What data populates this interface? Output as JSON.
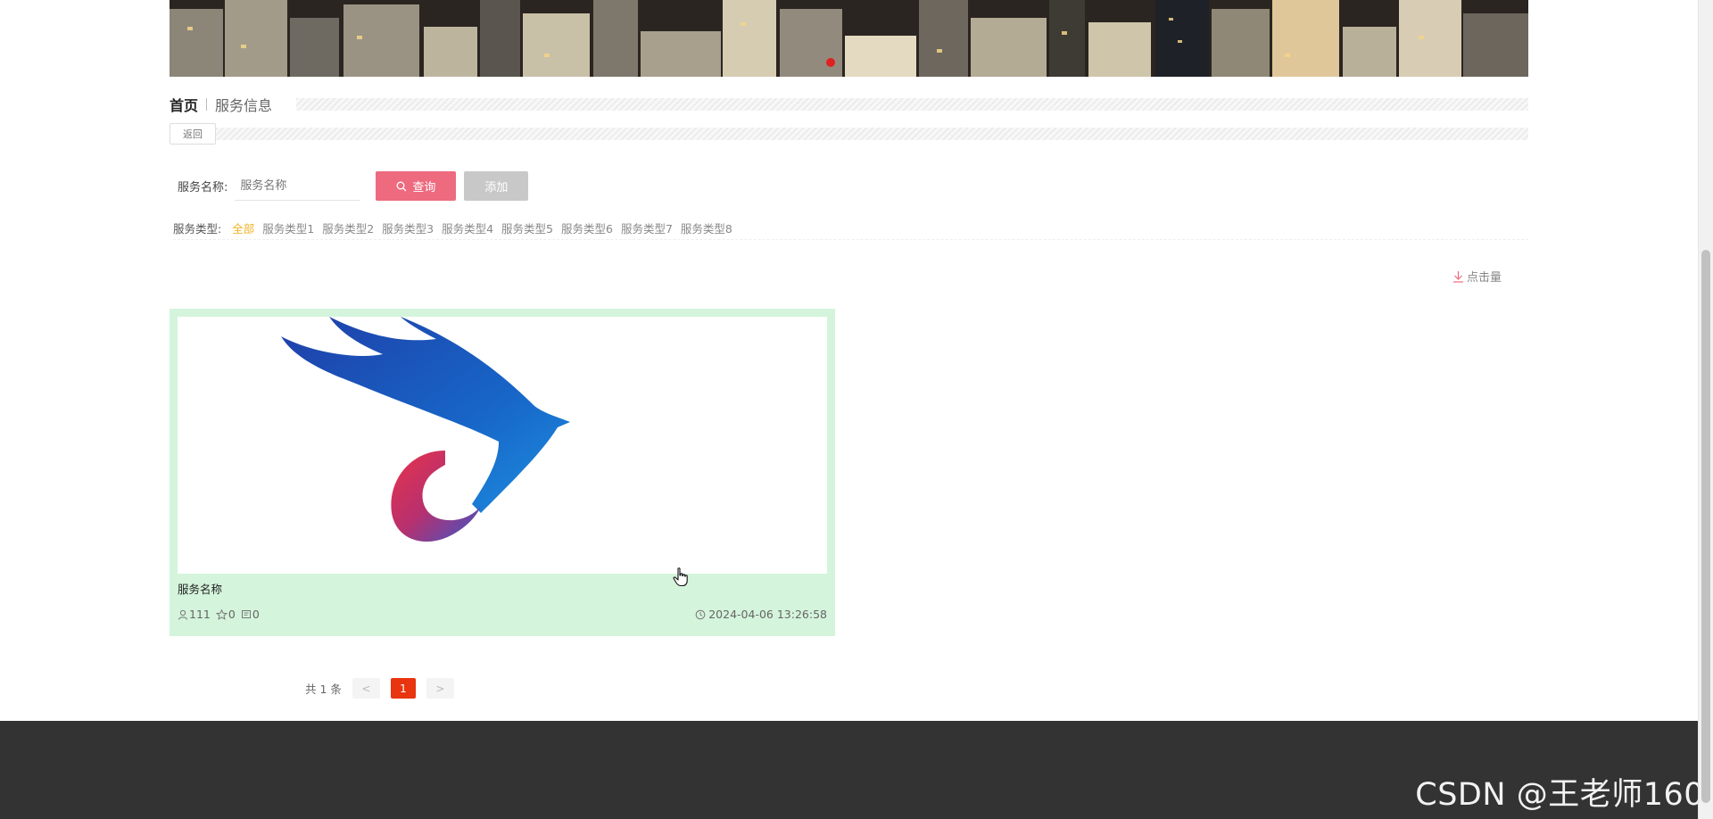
{
  "breadcrumb": {
    "home": "首页",
    "current": "服务信息"
  },
  "back_label": "返回",
  "search": {
    "label": "服务名称:",
    "placeholder": "服务名称",
    "query_label": "查询",
    "add_label": "添加"
  },
  "type_filter": {
    "label": "服务类型:",
    "options": [
      "全部",
      "服务类型1",
      "服务类型2",
      "服务类型3",
      "服务类型4",
      "服务类型5",
      "服务类型6",
      "服务类型7",
      "服务类型8"
    ],
    "selected": "全部"
  },
  "sort": {
    "label": "点击量"
  },
  "cards": [
    {
      "title": "服务名称",
      "views": "111",
      "favorites": "0",
      "comments": "0",
      "date": "2024-04-06 13:26:58"
    }
  ],
  "pagination": {
    "total_text": "共 1 条",
    "prev": "<",
    "current": "1",
    "next": ">"
  },
  "watermark": "CSDN @王老师160",
  "colors": {
    "accent": "#ee6a7f",
    "active_type": "#f0b429",
    "card_bg": "#d4f4dc",
    "page_current": "#e8340f",
    "footer": "#333333"
  }
}
